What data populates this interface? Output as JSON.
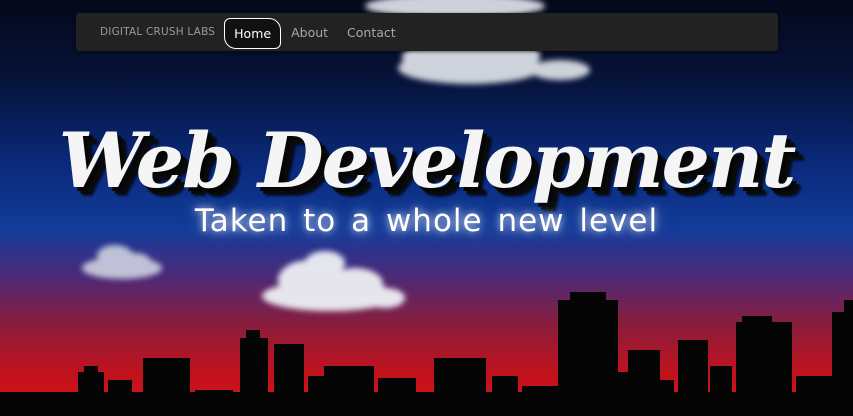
{
  "navbar": {
    "brand": "DIGITAL CRUSH LABS",
    "items": [
      {
        "label": "Home",
        "active": true
      },
      {
        "label": "About",
        "active": false
      },
      {
        "label": "Contact",
        "active": false
      }
    ]
  },
  "hero": {
    "title": "Web Development",
    "subtitle": "Taken to a whole new level"
  },
  "colors": {
    "sky_top": "#04081a",
    "sky_mid": "#0a2a7c",
    "sky_bottom": "#d5141c",
    "navbar_bg": "#222222",
    "skyline": "#050505"
  }
}
